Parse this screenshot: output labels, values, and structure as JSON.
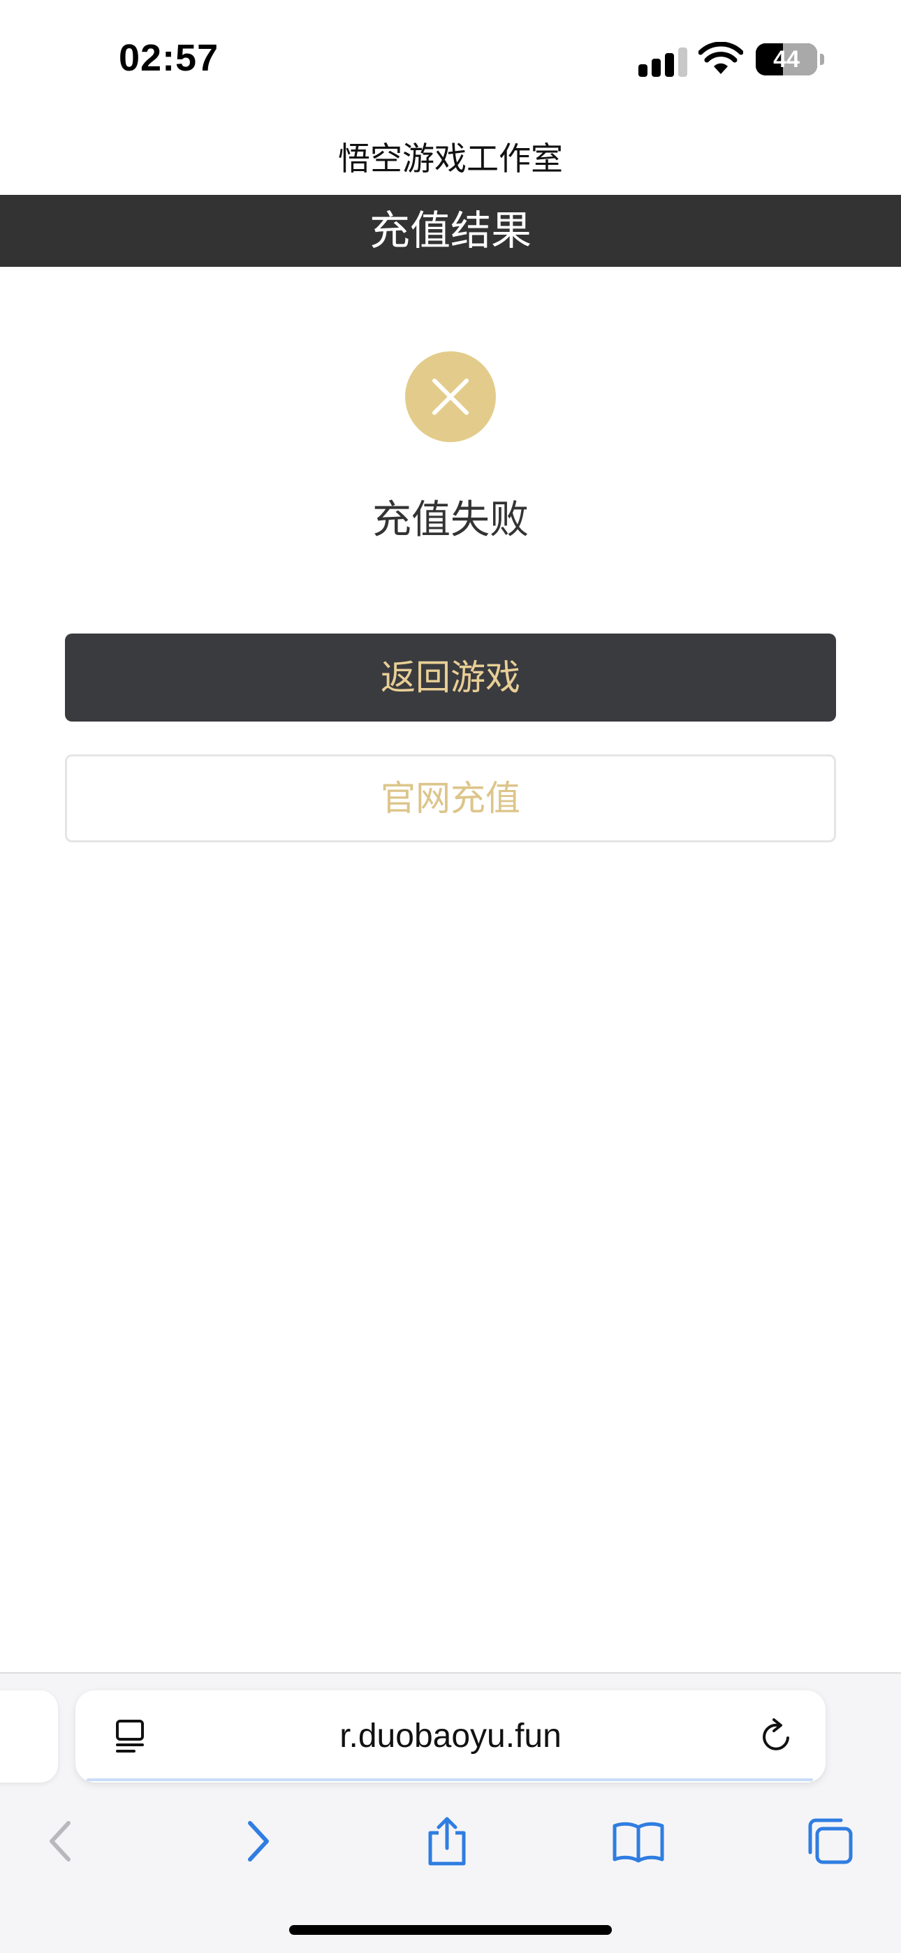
{
  "status_bar": {
    "time": "02:57",
    "battery_percent": "44",
    "signal_bars_active": 3,
    "signal_bars_total": 4
  },
  "site": {
    "title": "悟空游戏工作室"
  },
  "header": {
    "title": "充值结果"
  },
  "result": {
    "icon": "close-icon",
    "text": "充值失败"
  },
  "buttons": {
    "back_label": "返回游戏",
    "recharge_label": "官网充值"
  },
  "browser": {
    "url": "r.duobaoyu.fun",
    "icons": [
      "reader-mode-icon",
      "reload-icon",
      "back-icon",
      "forward-icon",
      "share-icon",
      "bookmarks-icon",
      "tabs-icon"
    ]
  },
  "colors": {
    "header_bg": "#333333",
    "accent_gold": "#e3cc8b",
    "button_dark": "#3a3b3f",
    "link_blue": "#2f7de1"
  }
}
